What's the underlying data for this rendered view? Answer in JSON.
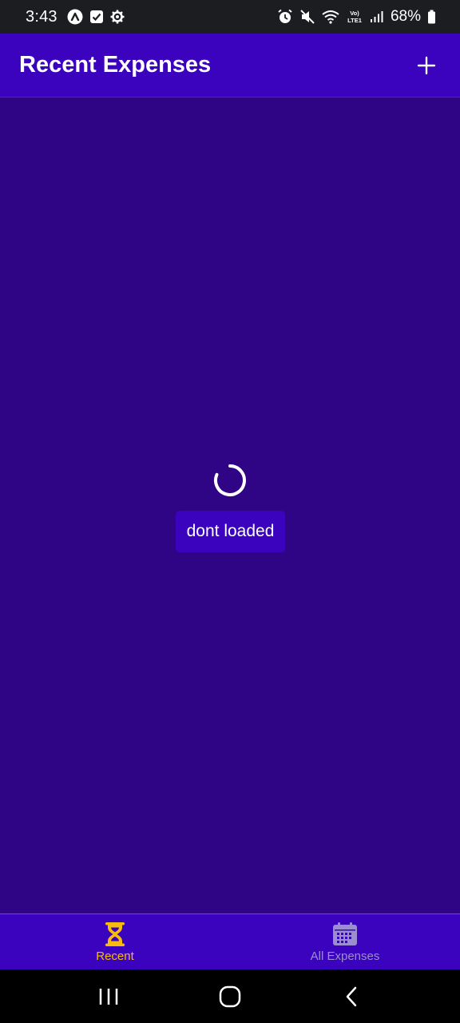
{
  "status_bar": {
    "time": "3:43",
    "battery": "68%",
    "left_icons": [
      "a-icon",
      "check-box-icon",
      "settings-icon"
    ],
    "right_icons": [
      "alarm-icon",
      "mute-icon",
      "wifi-icon",
      "volte-icon",
      "signal-icon",
      "battery-icon"
    ],
    "network_label": "Vo) LTE1"
  },
  "header": {
    "title": "Recent Expenses",
    "add_icon": "plus-icon"
  },
  "main": {
    "loading_icon": "spinner-icon",
    "message": "dont loaded"
  },
  "tabs": [
    {
      "label": "Recent",
      "icon": "hourglass-icon",
      "active": true
    },
    {
      "label": "All Expenses",
      "icon": "calendar-icon",
      "active": false
    }
  ],
  "nav": {
    "buttons": [
      "recent-apps-icon",
      "home-icon",
      "back-icon"
    ]
  },
  "colors": {
    "background": "#2f0586",
    "header": "#3b03bd",
    "accent": "#f7bc0c",
    "inactive": "#9a8ed0"
  }
}
